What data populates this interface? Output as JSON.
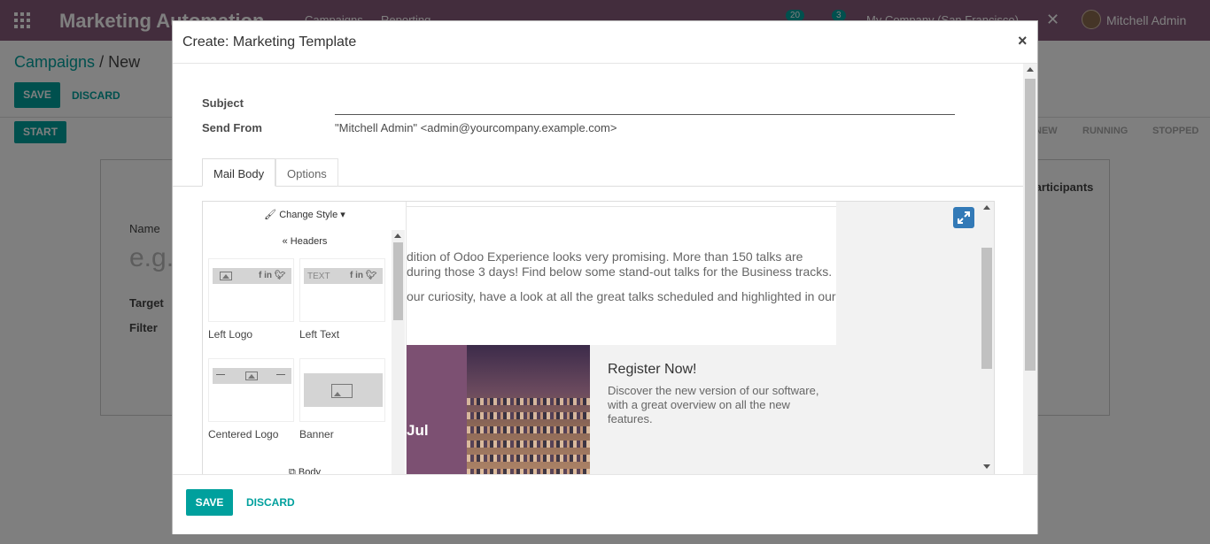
{
  "app": {
    "brand": "Marketing Automation",
    "menu": [
      "Campaigns",
      "Reporting"
    ],
    "badges": [
      "20",
      "3"
    ],
    "company": "My Company (San Francisco)",
    "user": "Mitchell Admin"
  },
  "breadcrumb": {
    "parent": "Campaigns",
    "separator": "/",
    "current": "New"
  },
  "control": {
    "save": "SAVE",
    "discard": "DISCARD",
    "start": "START"
  },
  "status_bar": [
    "NEW",
    "RUNNING",
    "STOPPED"
  ],
  "form_bg": {
    "name_label": "Name",
    "name_placeholder": "e.g.",
    "target_label": "Target",
    "filter_label": "Filter",
    "participants": "Participants"
  },
  "modal": {
    "title": "Create: Marketing Template",
    "close": "×",
    "subject_label": "Subject",
    "subject_value": "",
    "send_from_label": "Send From",
    "send_from_value": "\"Mitchell Admin\" <admin@yourcompany.example.com>",
    "tabs": [
      "Mail Body",
      "Options"
    ],
    "editor": {
      "change_style": "Change Style",
      "headers": "Headers",
      "body": "Body",
      "snippets": [
        "Left Logo",
        "Left Text",
        "Centered Logo",
        "Banner"
      ],
      "snippet_text_thumb": "TEXT",
      "paragraph_1": "dition of Odoo Experience looks very promising. More than 150 talks are",
      "paragraph_2": "during those 3 days! Find below some stand-out talks for the Business tracks.",
      "paragraph_3": "our curiosity, have a look at all the great talks scheduled and highlighted in our",
      "event_date": "Jul",
      "event_title": "Register Now!",
      "event_text": "Discover the new version of our software, with a great overview on all the new features."
    },
    "footer": {
      "save": "SAVE",
      "discard": "DISCARD"
    }
  },
  "colors": {
    "brand": "#875a7b",
    "primary": "#00a09d",
    "expand": "#337ab7",
    "event_purple": "#7c5072"
  }
}
